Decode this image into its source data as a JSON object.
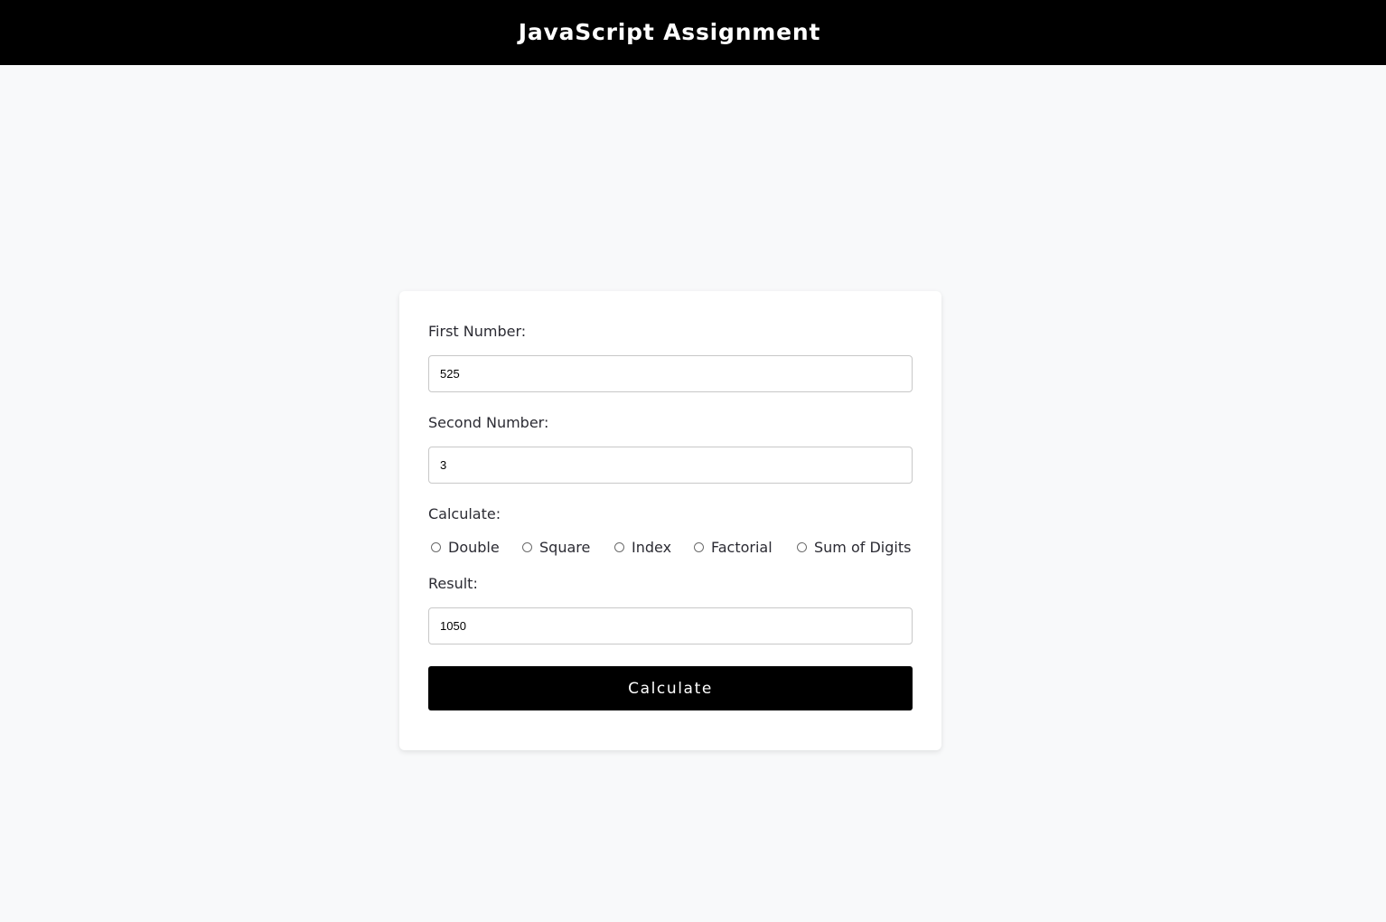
{
  "header": {
    "title": "JavaScript Assignment",
    "background": "#000000",
    "text_color": "#ffffff"
  },
  "form": {
    "first_number": {
      "label": "First Number:",
      "value": "525"
    },
    "second_number": {
      "label": "Second Number:",
      "value": "3"
    },
    "calculate": {
      "label": "Calculate:",
      "options": [
        {
          "label": "Double",
          "selected": false
        },
        {
          "label": "Square",
          "selected": false
        },
        {
          "label": "Index",
          "selected": false
        },
        {
          "label": "Factorial",
          "selected": false
        },
        {
          "label": "Sum of Digits",
          "selected": false
        }
      ]
    },
    "result": {
      "label": "Result:",
      "value": "1050"
    },
    "submit_label": "Calculate",
    "button_color": "#000000"
  }
}
